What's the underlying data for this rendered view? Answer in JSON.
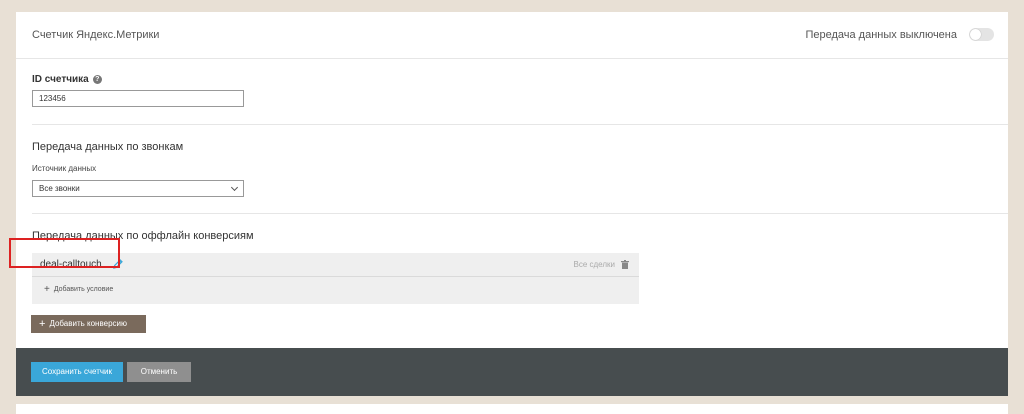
{
  "header": {
    "title": "Счетчик Яндекс.Метрики",
    "toggle_label": "Передача данных выключена",
    "toggle_on": false
  },
  "counter": {
    "label": "ID счетчика",
    "help_icon": "?",
    "value": "123456"
  },
  "calls": {
    "title": "Передача данных по звонкам",
    "source_label": "Источник данных",
    "source_value": "Все звонки"
  },
  "offline": {
    "title": "Передача данных по оффлайн конверсиям",
    "conversion_name": "deal-calltouch",
    "conversion_meta": "Все сделки",
    "add_condition": "Добавить условие",
    "add_conversion": "Добавить конверсию"
  },
  "footer": {
    "save": "Сохранить счетчик",
    "cancel": "Отменить"
  },
  "icons": [
    "help-icon",
    "pencil-icon",
    "trash-icon",
    "chevron-down-icon",
    "plus-icon"
  ],
  "colors": {
    "background": "#e8e0d5",
    "primary_button": "#3aa7d9",
    "add_button": "#7a6a5c",
    "footer": "#474d4f",
    "highlight": "#dd2222"
  }
}
